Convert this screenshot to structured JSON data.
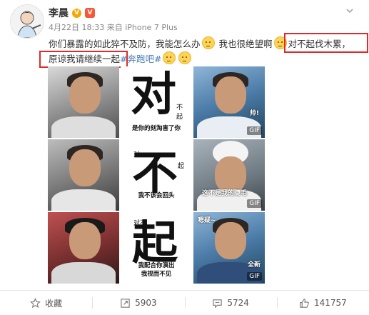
{
  "post": {
    "author": "李晨",
    "verified_badge": "V",
    "vip_badge": "V",
    "time": "4月22日 18:33",
    "source": "来自 iPhone 7 Plus",
    "text_line1_a": "你们暴露的如此猝不及防，我能怎么办",
    "text_line1_b": "我也很绝望啊",
    "text_line1_c": "对不起伐木累，",
    "text_line2_a": "原谅我请继续一起",
    "hashtag": "#奔跑吧#"
  },
  "images": {
    "cell2": {
      "big": "对",
      "side": "不起",
      "caption": "是你的刻淘害了你"
    },
    "cell3": {
      "sticker": "帅!",
      "tag": "GIF"
    },
    "cell5": {
      "big": "不",
      "top_small": "对",
      "side": "起",
      "caption": "我不该会回头"
    },
    "cell6": {
      "sticker": "这不是我的睫毛",
      "tag": "GIF"
    },
    "cell8": {
      "big": "起",
      "top_small": "对不",
      "caption_a": "我配合你演出",
      "caption_b": "我视而不见"
    },
    "cell9": {
      "sticker": "嗯疑~",
      "sticker2": "全新",
      "tag": "GIF"
    }
  },
  "actions": [
    {
      "label": "收藏",
      "icon": "star-icon"
    },
    {
      "label": "5903",
      "icon": "share-icon"
    },
    {
      "label": "5724",
      "icon": "comment-icon"
    },
    {
      "label": "141757",
      "icon": "thumbs-up-icon"
    }
  ],
  "colors": {
    "highlight_box": "#e02a2a",
    "hashtag": "#4d7fb8",
    "verified": "#f7a600"
  }
}
